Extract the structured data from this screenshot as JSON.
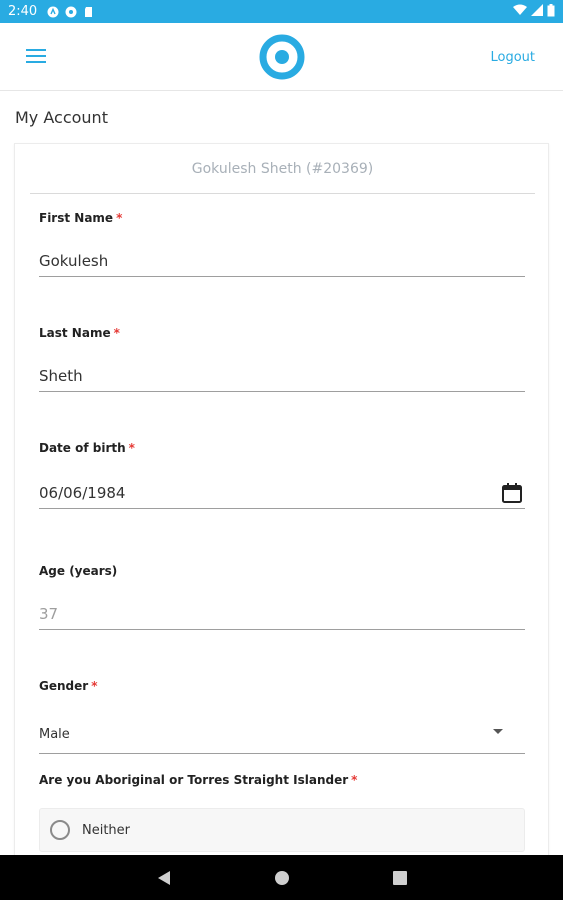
{
  "status_bar": {
    "time": "2:40",
    "left_icons": [
      "assistant-icon",
      "photos-icon",
      "sd-card-icon"
    ],
    "right_icons": [
      "wifi-icon",
      "signal-icon",
      "battery-icon"
    ]
  },
  "app_bar": {
    "menu_icon": "hamburger-menu-icon",
    "logo_icon": "ring-logo-icon",
    "logout_label": "Logout",
    "accent_color": "#29abe2"
  },
  "page": {
    "title": "My Account"
  },
  "card": {
    "header": "Gokulesh Sheth (#20369)",
    "fields": {
      "first_name": {
        "label": "First Name",
        "required": "*",
        "value": "Gokulesh"
      },
      "last_name": {
        "label": "Last Name",
        "required": "*",
        "value": "Sheth"
      },
      "dob": {
        "label": "Date of birth",
        "required": "*",
        "value": "06/06/1984",
        "icon": "calendar-icon"
      },
      "age": {
        "label": "Age (years)",
        "value": "37"
      },
      "gender": {
        "label": "Gender",
        "required": "*",
        "value": "Male",
        "icon": "dropdown-caret-icon"
      },
      "indigenous": {
        "label": "Are you Aboriginal or Torres Straight Islander",
        "required": "*",
        "option": "Neither"
      }
    }
  },
  "nav_bar": {
    "buttons": [
      "back-icon",
      "home-icon",
      "recents-icon"
    ]
  }
}
